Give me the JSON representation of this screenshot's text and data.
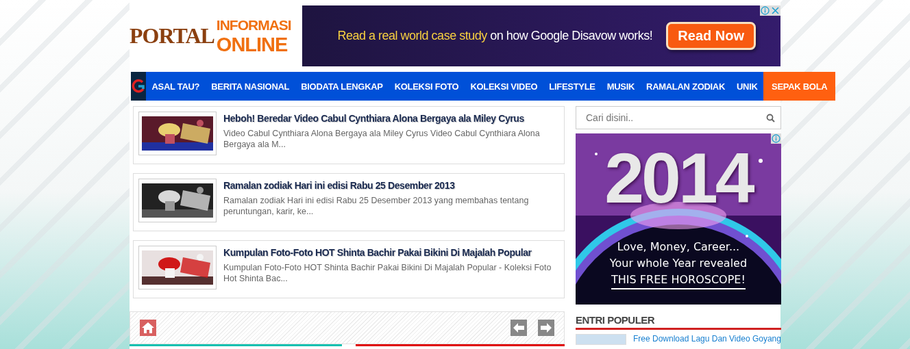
{
  "logo": {
    "word_1": "PORTAL",
    "word_2": "INFORMASI",
    "word_3": "ONLINE"
  },
  "banner_ad": {
    "text_highlight": "Read a real world case study",
    "text_rest": "on how Google Disavow works!",
    "button": "Read Now"
  },
  "nav": {
    "items": [
      {
        "label": "ASAL TAU?",
        "selected": false
      },
      {
        "label": "BERITA NASIONAL",
        "selected": false
      },
      {
        "label": "BIODATA LENGKAP",
        "selected": false
      },
      {
        "label": "KOLEKSI FOTO",
        "selected": false
      },
      {
        "label": "KOLEKSI VIDEO",
        "selected": false
      },
      {
        "label": "LIFESTYLE",
        "selected": false
      },
      {
        "label": "MUSIK",
        "selected": false
      },
      {
        "label": "RAMALAN ZODIAK",
        "selected": false
      },
      {
        "label": "UNIK",
        "selected": false
      },
      {
        "label": "SEPAK BOLA",
        "selected": true
      }
    ]
  },
  "posts": [
    {
      "title": "Heboh! Beredar Video Cabul Cynthiara Alona Bergaya ala Miley Cyrus",
      "excerpt": "Video Cabul Cynthiara Alona Bergaya ala Miley Cyrus Video Cabul Cynthiara Alona Bergaya ala M..."
    },
    {
      "title": "Ramalan zodiak Hari ini edisi Rabu 25 Desember 2013",
      "excerpt": "Ramalan zodiak Hari ini edisi  Rabu 25 Desember 2013   yang membahas tentang peruntungan, karir, ke..."
    },
    {
      "title": "Kumpulan Foto-Foto HOT Shinta Bachir Pakai Bikini Di Majalah Popular",
      "excerpt": "Kumpulan Foto-Foto HOT Shinta Bachir Pakai Bikini Di Majalah Popular -  Koleksi Foto Hot Shinta Bac..."
    }
  ],
  "search": {
    "placeholder": "Cari disini.."
  },
  "side_ad": {
    "year": "2014",
    "line_1": "Love, Money, Career...",
    "line_2": "Your whole Year revealed",
    "line_3": "THIS FREE HOROSCOPE!"
  },
  "popular": {
    "heading": "ENTRI POPULER",
    "items": [
      {
        "title": "Free Download Lagu Dan Video Goyang"
      }
    ]
  }
}
